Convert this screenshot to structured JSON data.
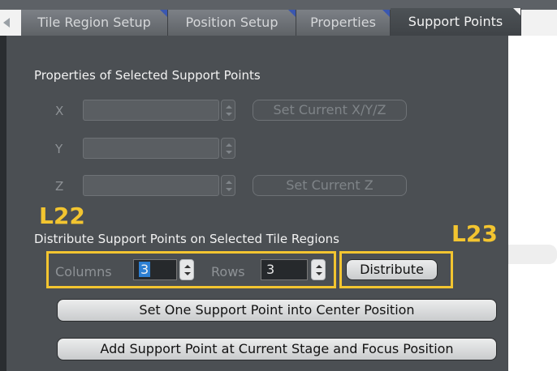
{
  "tabs": [
    {
      "label": "Tile Region Setup",
      "active": false
    },
    {
      "label": "Position Setup",
      "active": false
    },
    {
      "label": "Properties",
      "active": false
    },
    {
      "label": "Support Points",
      "active": true
    }
  ],
  "properties_section": {
    "title": "Properties of Selected Support Points",
    "x_label": "X",
    "y_label": "Y",
    "z_label": "Z",
    "x_value": "",
    "y_value": "",
    "z_value": "",
    "set_xyz_label": "Set Current X/Y/Z",
    "set_z_label": "Set Current Z"
  },
  "distribute_section": {
    "title": "Distribute Support Points on Selected Tile Regions",
    "columns_label": "Columns",
    "columns_value": "3",
    "rows_label": "Rows",
    "rows_value": "3",
    "distribute_label": "Distribute",
    "center_point_label": "Set One Support Point into Center Position",
    "add_point_label": "Add Support Point at Current Stage and Focus Position"
  },
  "annotations": {
    "l22": "L22",
    "l23": "L23"
  },
  "colors": {
    "panel": "#4b4f53",
    "highlight": "#f3c530",
    "selection": "#2d7fd2"
  }
}
